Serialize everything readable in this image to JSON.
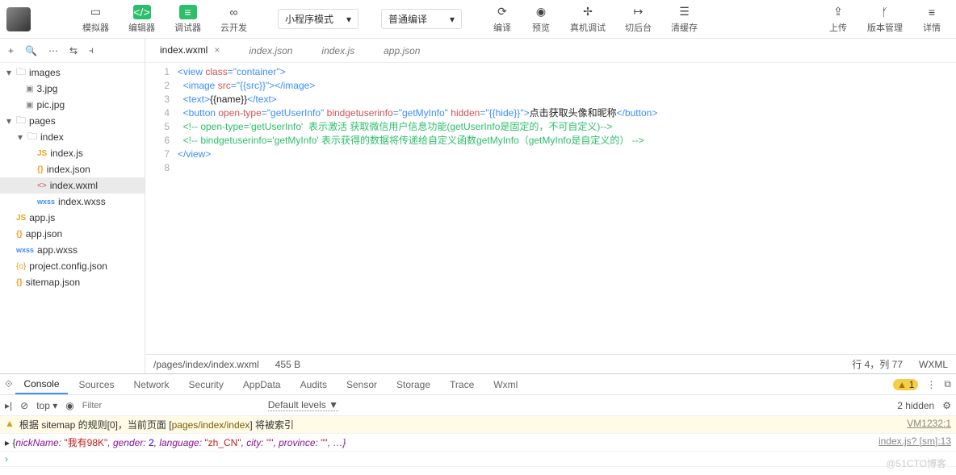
{
  "toolbar": {
    "simulator": "模拟器",
    "editor": "编辑器",
    "debugger": "调试器",
    "cloud": "云开发",
    "miniProgramMode": "小程序模式",
    "compileMode": "普通编译",
    "compile": "编译",
    "preview": "预览",
    "remote": "真机调试",
    "background": "切后台",
    "clearCache": "清缓存",
    "upload": "上传",
    "version": "版本管理",
    "details": "详情"
  },
  "tree": {
    "images": "images",
    "img1": "3.jpg",
    "img2": "pic.jpg",
    "pages": "pages",
    "index": "index",
    "indexjs": "index.js",
    "indexjson": "index.json",
    "indexwxml": "index.wxml",
    "indexwxss": "index.wxss",
    "appjs": "app.js",
    "appjson": "app.json",
    "appwxss": "app.wxss",
    "projcfg": "project.config.json",
    "sitemap": "sitemap.json"
  },
  "tabs": {
    "t0": "index.wxml",
    "t1": "index.json",
    "t2": "index.js",
    "t3": "app.json"
  },
  "code": {
    "l1a": "<view ",
    "l1b": "class",
    "l1c": "=\"container\"",
    "l1d": ">",
    "l2a": "  <image ",
    "l2b": "src",
    "l2c": "=\"{{src}}\"",
    "l2d": "></image>",
    "l3a": "  <text>",
    "l3b": "{{name}}",
    "l3c": "</text>",
    "l4a": "  <button ",
    "l4b": "open-type",
    "l4c": "=\"getUserInfo\" ",
    "l4d": "bindgetuserinfo",
    "l4e": "=\"getMyInfo\" ",
    "l4f": "hidden",
    "l4g": "=\"{{hide}}\"",
    "l4h": ">",
    "l4i": "点击获取头像和昵称",
    "l4j": "</button>",
    "l5": "  <!-- open-type='getUserInfo'  表示激活 获取微信用户信息功能(getUserInfo是固定的，不可自定义)-->",
    "l6": "  <!-- bindgetuserinfo='getMyInfo' 表示获得的数据将传递给自定义函数getMyInfo（getMyInfo是自定义的） -->",
    "l7": "</view>"
  },
  "status": {
    "path": "/pages/index/index.wxml",
    "size": "455 B",
    "pos": "行 4，列 77",
    "lang": "WXML"
  },
  "devtools": {
    "tabs": {
      "console": "Console",
      "sources": "Sources",
      "network": "Network",
      "security": "Security",
      "appdata": "AppData",
      "audits": "Audits",
      "sensor": "Sensor",
      "storage": "Storage",
      "trace": "Trace",
      "wxml": "Wxml"
    },
    "warnCount": "1",
    "filter": {
      "top": "top",
      "placeholder": "Filter",
      "levels": "Default levels ▼",
      "hidden": "2 hidden"
    },
    "line1": {
      "pre": "根据 sitemap 的规则[0]，当前页面 [",
      "path": "pages/index/index",
      "post": "] 将被索引",
      "src": "VM1232:1"
    },
    "line2": {
      "open": "▸ {",
      "k1": "nickName: ",
      "v1": "\"我有98K\"",
      "k2": ", gender: ",
      "v2": "2",
      "k3": ", language: ",
      "v3": "\"zh_CN\"",
      "k4": ", city: ",
      "v4": "\"\"",
      "k5": ", province: ",
      "v5": "\"\"",
      "k6": ", …}",
      "src": "index.js? [sm]:13"
    }
  },
  "watermark": "@51CTO博客"
}
